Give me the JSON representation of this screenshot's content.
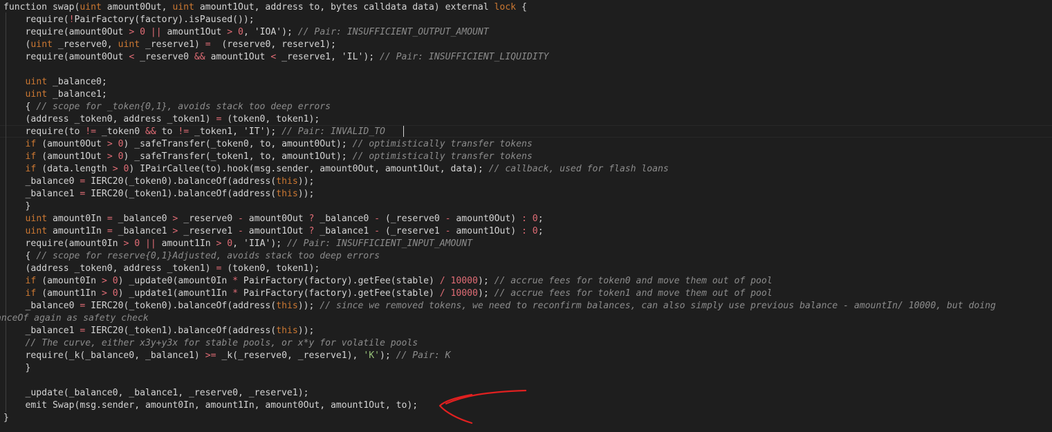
{
  "editor": {
    "theme": {
      "background": "#1e1e1e",
      "text": "#d4d4d4",
      "keyword": "#cc7832",
      "operator": "#e06c75",
      "number": "#e06c75",
      "string": "#98c379",
      "comment": "#8c8c8c",
      "annotation": "#e02020"
    },
    "lines": [
      [
        {
          "t": "function swap(",
          "c": "p"
        },
        {
          "t": "uint",
          "c": "k"
        },
        {
          "t": " amount0Out, ",
          "c": "p"
        },
        {
          "t": "uint",
          "c": "k"
        },
        {
          "t": " amount1Out, address to, bytes calldata data) external ",
          "c": "p"
        },
        {
          "t": "lock",
          "c": "k"
        },
        {
          "t": " {",
          "c": "p"
        }
      ],
      [
        {
          "t": "    require(",
          "c": "p"
        },
        {
          "t": "!",
          "c": "o"
        },
        {
          "t": "PairFactory(factory).isPaused());",
          "c": "p"
        }
      ],
      [
        {
          "t": "    require(amount0Out ",
          "c": "p"
        },
        {
          "t": ">",
          "c": "o"
        },
        {
          "t": " ",
          "c": "p"
        },
        {
          "t": "0",
          "c": "n"
        },
        {
          "t": " ",
          "c": "p"
        },
        {
          "t": "||",
          "c": "o"
        },
        {
          "t": " amount1Out ",
          "c": "p"
        },
        {
          "t": ">",
          "c": "o"
        },
        {
          "t": " ",
          "c": "p"
        },
        {
          "t": "0",
          "c": "n"
        },
        {
          "t": ", 'IOA'); ",
          "c": "p"
        },
        {
          "t": "// Pair: INSUFFICIENT_OUTPUT_AMOUNT",
          "c": "c"
        }
      ],
      [
        {
          "t": "    (",
          "c": "p"
        },
        {
          "t": "uint",
          "c": "k"
        },
        {
          "t": " _reserve0, ",
          "c": "p"
        },
        {
          "t": "uint",
          "c": "k"
        },
        {
          "t": " _reserve1) ",
          "c": "p"
        },
        {
          "t": "=",
          "c": "o"
        },
        {
          "t": "  (reserve0, reserve1);",
          "c": "p"
        }
      ],
      [
        {
          "t": "    require(amount0Out ",
          "c": "p"
        },
        {
          "t": "<",
          "c": "o"
        },
        {
          "t": " _reserve0 ",
          "c": "p"
        },
        {
          "t": "&&",
          "c": "o"
        },
        {
          "t": " amount1Out ",
          "c": "p"
        },
        {
          "t": "<",
          "c": "o"
        },
        {
          "t": " _reserve1, 'IL'); ",
          "c": "p"
        },
        {
          "t": "// Pair: INSUFFICIENT_LIQUIDITY",
          "c": "c"
        }
      ],
      [],
      [
        {
          "t": "    ",
          "c": "p"
        },
        {
          "t": "uint",
          "c": "k"
        },
        {
          "t": " _balance0;",
          "c": "p"
        }
      ],
      [
        {
          "t": "    ",
          "c": "p"
        },
        {
          "t": "uint",
          "c": "k"
        },
        {
          "t": " _balance1;",
          "c": "p"
        }
      ],
      [
        {
          "t": "    { ",
          "c": "p"
        },
        {
          "t": "// scope for _token{0,1}, avoids stack too deep errors",
          "c": "c"
        }
      ],
      [
        {
          "t": "    (address _token0, address _token1) ",
          "c": "p"
        },
        {
          "t": "=",
          "c": "o"
        },
        {
          "t": " (token0, token1);",
          "c": "p"
        }
      ],
      [
        {
          "t": "    require(to ",
          "c": "p"
        },
        {
          "t": "!=",
          "c": "o"
        },
        {
          "t": " _token0 ",
          "c": "p"
        },
        {
          "t": "&&",
          "c": "o"
        },
        {
          "t": " to ",
          "c": "p"
        },
        {
          "t": "!=",
          "c": "o"
        },
        {
          "t": " _token1, 'IT'); ",
          "c": "p"
        },
        {
          "t": "// Pair: INVALID_TO",
          "c": "c"
        }
      ],
      [
        {
          "t": "    ",
          "c": "p"
        },
        {
          "t": "if",
          "c": "k"
        },
        {
          "t": " (amount0Out ",
          "c": "p"
        },
        {
          "t": ">",
          "c": "o"
        },
        {
          "t": " ",
          "c": "p"
        },
        {
          "t": "0",
          "c": "n"
        },
        {
          "t": ") _safeTransfer(_token0, to, amount0Out); ",
          "c": "p"
        },
        {
          "t": "// optimistically transfer tokens",
          "c": "c"
        }
      ],
      [
        {
          "t": "    ",
          "c": "p"
        },
        {
          "t": "if",
          "c": "k"
        },
        {
          "t": " (amount1Out ",
          "c": "p"
        },
        {
          "t": ">",
          "c": "o"
        },
        {
          "t": " ",
          "c": "p"
        },
        {
          "t": "0",
          "c": "n"
        },
        {
          "t": ") _safeTransfer(_token1, to, amount1Out); ",
          "c": "p"
        },
        {
          "t": "// optimistically transfer tokens",
          "c": "c"
        }
      ],
      [
        {
          "t": "    ",
          "c": "p"
        },
        {
          "t": "if",
          "c": "k"
        },
        {
          "t": " (data.length ",
          "c": "p"
        },
        {
          "t": ">",
          "c": "o"
        },
        {
          "t": " ",
          "c": "p"
        },
        {
          "t": "0",
          "c": "n"
        },
        {
          "t": ") IPairCallee(to).hook(msg.sender, amount0Out, amount1Out, data); ",
          "c": "p"
        },
        {
          "t": "// callback, used for flash loans",
          "c": "c"
        }
      ],
      [
        {
          "t": "    _balance0 ",
          "c": "p"
        },
        {
          "t": "=",
          "c": "o"
        },
        {
          "t": " IERC20(_token0).balanceOf(address(",
          "c": "p"
        },
        {
          "t": "this",
          "c": "k"
        },
        {
          "t": "));",
          "c": "p"
        }
      ],
      [
        {
          "t": "    _balance1 ",
          "c": "p"
        },
        {
          "t": "=",
          "c": "o"
        },
        {
          "t": " IERC20(_token1).balanceOf(address(",
          "c": "p"
        },
        {
          "t": "this",
          "c": "k"
        },
        {
          "t": "));",
          "c": "p"
        }
      ],
      [
        {
          "t": "    }",
          "c": "p"
        }
      ],
      [
        {
          "t": "    ",
          "c": "p"
        },
        {
          "t": "uint",
          "c": "k"
        },
        {
          "t": " amount0In ",
          "c": "p"
        },
        {
          "t": "=",
          "c": "o"
        },
        {
          "t": " _balance0 ",
          "c": "p"
        },
        {
          "t": ">",
          "c": "o"
        },
        {
          "t": " _reserve0 ",
          "c": "p"
        },
        {
          "t": "-",
          "c": "o"
        },
        {
          "t": " amount0Out ",
          "c": "p"
        },
        {
          "t": "?",
          "c": "o"
        },
        {
          "t": " _balance0 ",
          "c": "p"
        },
        {
          "t": "-",
          "c": "o"
        },
        {
          "t": " (_reserve0 ",
          "c": "p"
        },
        {
          "t": "-",
          "c": "o"
        },
        {
          "t": " amount0Out) ",
          "c": "p"
        },
        {
          "t": ":",
          "c": "o"
        },
        {
          "t": " ",
          "c": "p"
        },
        {
          "t": "0",
          "c": "n"
        },
        {
          "t": ";",
          "c": "p"
        }
      ],
      [
        {
          "t": "    ",
          "c": "p"
        },
        {
          "t": "uint",
          "c": "k"
        },
        {
          "t": " amount1In ",
          "c": "p"
        },
        {
          "t": "=",
          "c": "o"
        },
        {
          "t": " _balance1 ",
          "c": "p"
        },
        {
          "t": ">",
          "c": "o"
        },
        {
          "t": " _reserve1 ",
          "c": "p"
        },
        {
          "t": "-",
          "c": "o"
        },
        {
          "t": " amount1Out ",
          "c": "p"
        },
        {
          "t": "?",
          "c": "o"
        },
        {
          "t": " _balance1 ",
          "c": "p"
        },
        {
          "t": "-",
          "c": "o"
        },
        {
          "t": " (_reserve1 ",
          "c": "p"
        },
        {
          "t": "-",
          "c": "o"
        },
        {
          "t": " amount1Out) ",
          "c": "p"
        },
        {
          "t": ":",
          "c": "o"
        },
        {
          "t": " ",
          "c": "p"
        },
        {
          "t": "0",
          "c": "n"
        },
        {
          "t": ";",
          "c": "p"
        }
      ],
      [
        {
          "t": "    require(amount0In ",
          "c": "p"
        },
        {
          "t": ">",
          "c": "o"
        },
        {
          "t": " ",
          "c": "p"
        },
        {
          "t": "0",
          "c": "n"
        },
        {
          "t": " ",
          "c": "p"
        },
        {
          "t": "||",
          "c": "o"
        },
        {
          "t": " amount1In ",
          "c": "p"
        },
        {
          "t": ">",
          "c": "o"
        },
        {
          "t": " ",
          "c": "p"
        },
        {
          "t": "0",
          "c": "n"
        },
        {
          "t": ", 'IIA'); ",
          "c": "p"
        },
        {
          "t": "// Pair: INSUFFICIENT_INPUT_AMOUNT",
          "c": "c"
        }
      ],
      [
        {
          "t": "    { ",
          "c": "p"
        },
        {
          "t": "// scope for reserve{0,1}Adjusted, avoids stack too deep errors",
          "c": "c"
        }
      ],
      [
        {
          "t": "    (address _token0, address _token1) ",
          "c": "p"
        },
        {
          "t": "=",
          "c": "o"
        },
        {
          "t": " (token0, token1);",
          "c": "p"
        }
      ],
      [
        {
          "t": "    ",
          "c": "p"
        },
        {
          "t": "if",
          "c": "k"
        },
        {
          "t": " (amount0In ",
          "c": "p"
        },
        {
          "t": ">",
          "c": "o"
        },
        {
          "t": " ",
          "c": "p"
        },
        {
          "t": "0",
          "c": "n"
        },
        {
          "t": ") _update0(amount0In ",
          "c": "p"
        },
        {
          "t": "*",
          "c": "o"
        },
        {
          "t": " PairFactory(factory).getFee(stable) ",
          "c": "p"
        },
        {
          "t": "/",
          "c": "o"
        },
        {
          "t": " ",
          "c": "p"
        },
        {
          "t": "10000",
          "c": "n"
        },
        {
          "t": "); ",
          "c": "p"
        },
        {
          "t": "// accrue fees for token0 and move them out of pool",
          "c": "c"
        }
      ],
      [
        {
          "t": "    ",
          "c": "p"
        },
        {
          "t": "if",
          "c": "k"
        },
        {
          "t": " (amount1In ",
          "c": "p"
        },
        {
          "t": ">",
          "c": "o"
        },
        {
          "t": " ",
          "c": "p"
        },
        {
          "t": "0",
          "c": "n"
        },
        {
          "t": ") _update1(amount1In ",
          "c": "p"
        },
        {
          "t": "*",
          "c": "o"
        },
        {
          "t": " PairFactory(factory).getFee(stable) ",
          "c": "p"
        },
        {
          "t": "/",
          "c": "o"
        },
        {
          "t": " ",
          "c": "p"
        },
        {
          "t": "10000",
          "c": "n"
        },
        {
          "t": "); ",
          "c": "p"
        },
        {
          "t": "// accrue fees for token1 and move them out of pool",
          "c": "c"
        }
      ],
      [
        {
          "t": "    _balance0 ",
          "c": "p"
        },
        {
          "t": "=",
          "c": "o"
        },
        {
          "t": " IERC20(_token0).balanceOf(address(",
          "c": "p"
        },
        {
          "t": "this",
          "c": "k"
        },
        {
          "t": ")); ",
          "c": "p"
        },
        {
          "t": "// since we removed tokens, we need to reconfirm balances, can also simply use previous balance - amountIn/ 10000, but doing",
          "c": "c"
        }
      ],
      [
        {
          "t": "anceOf again as safety check",
          "c": "c"
        }
      ],
      [
        {
          "t": "    _balance1 ",
          "c": "p"
        },
        {
          "t": "=",
          "c": "o"
        },
        {
          "t": " IERC20(_token1).balanceOf(address(",
          "c": "p"
        },
        {
          "t": "this",
          "c": "k"
        },
        {
          "t": "));",
          "c": "p"
        }
      ],
      [
        {
          "t": "    ",
          "c": "p"
        },
        {
          "t": "// The curve, either x3y+y3x for stable pools, or x*y for volatile pools",
          "c": "c"
        }
      ],
      [
        {
          "t": "    require(_k(_balance0, _balance1) ",
          "c": "p"
        },
        {
          "t": ">=",
          "c": "o"
        },
        {
          "t": " _k(_reserve0, _reserve1), ",
          "c": "p"
        },
        {
          "t": "'K'",
          "c": "s"
        },
        {
          "t": "); ",
          "c": "p"
        },
        {
          "t": "// Pair: K",
          "c": "c"
        }
      ],
      [
        {
          "t": "    }",
          "c": "p"
        }
      ],
      [],
      [
        {
          "t": "    _update(_balance0, _balance1, _reserve0, _reserve1);",
          "c": "p"
        }
      ],
      [
        {
          "t": "    emit Swap(msg.sender, amount0In, amount1In, amount0Out, amount1Out, to);",
          "c": "p"
        }
      ],
      [
        {
          "t": "}",
          "c": "p"
        }
      ]
    ]
  }
}
